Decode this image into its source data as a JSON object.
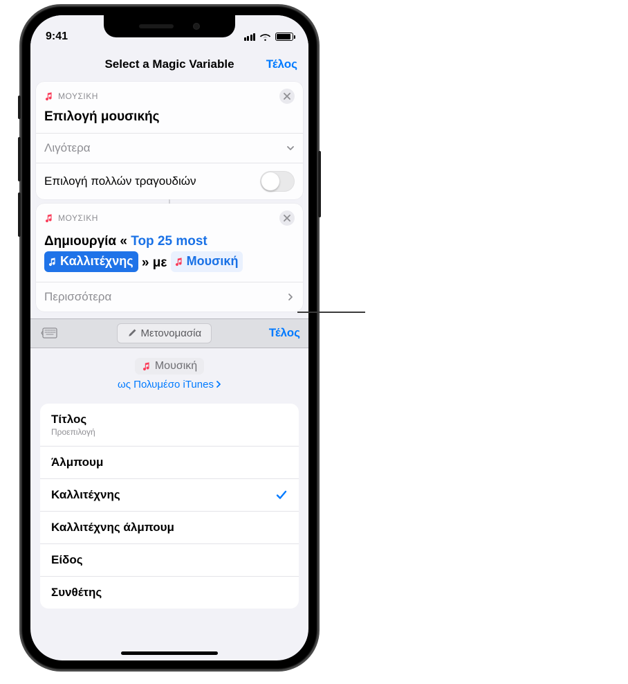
{
  "status": {
    "time": "9:41"
  },
  "nav": {
    "title": "Select a Magic Variable",
    "done": "Τέλος"
  },
  "card1": {
    "app": "ΜΟΥΣΙΚΗ",
    "title": "Επιλογή μουσικής",
    "less": "Λιγότερα",
    "multi": "Επιλογή πολλών τραγουδιών"
  },
  "card2": {
    "app": "ΜΟΥΣΙΚΗ",
    "pre": "Δημιουργία «",
    "top": "Top 25 most",
    "artist": "Καλλιτέχνης",
    "mid": "» με",
    "music": "Μουσική",
    "more": "Περισσότερα"
  },
  "toolbar": {
    "rename": "Μετονομασία",
    "done": "Τέλος"
  },
  "varHeader": {
    "name": "Μουσική",
    "as": "ως Πολυμέσο iTunes"
  },
  "options": {
    "title": "Τίτλος",
    "default": "Προεπιλογή",
    "album": "Άλμπουμ",
    "artist": "Καλλιτέχνης",
    "albumArtist": "Καλλιτέχνης άλμπουμ",
    "genre": "Είδος",
    "composer": "Συνθέτης"
  }
}
